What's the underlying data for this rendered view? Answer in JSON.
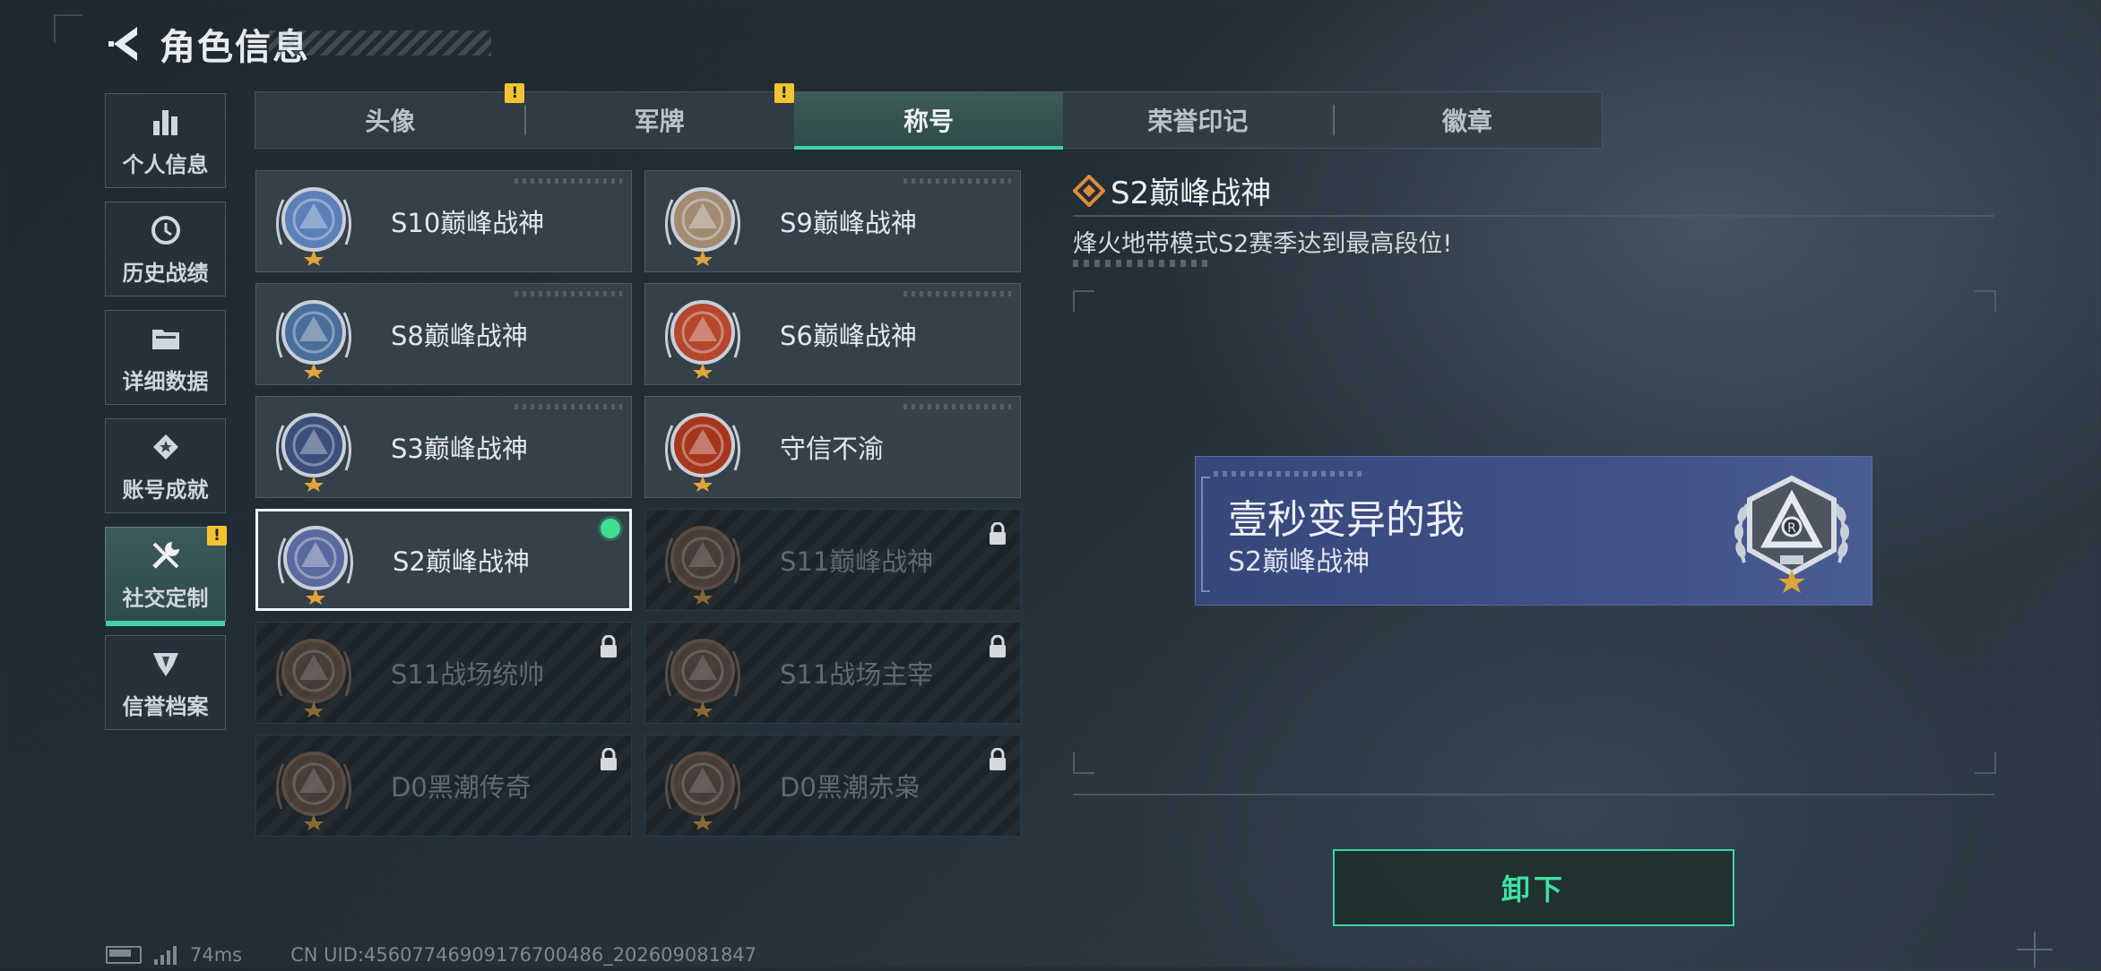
{
  "header": {
    "title": "角色信息",
    "back_icon": "back-arrow-icon"
  },
  "sidenav": [
    {
      "label": "个人信息",
      "icon": "bar-chart-icon",
      "badge": ""
    },
    {
      "label": "历史战绩",
      "icon": "clock-history-icon",
      "badge": ""
    },
    {
      "label": "详细数据",
      "icon": "folder-icon",
      "badge": ""
    },
    {
      "label": "账号成就",
      "icon": "medal-icon",
      "badge": ""
    },
    {
      "label": "社交定制",
      "icon": "tools-icon",
      "badge": "!",
      "active": true
    },
    {
      "label": "信誉档案",
      "icon": "shield-emblem-icon",
      "badge": ""
    }
  ],
  "tabs": [
    {
      "label": "头像",
      "badge": "!"
    },
    {
      "label": "军牌",
      "badge": "!"
    },
    {
      "label": "称号",
      "badge": "",
      "active": true
    },
    {
      "label": "荣誉印记",
      "badge": ""
    },
    {
      "label": "徽章",
      "badge": ""
    }
  ],
  "titles": [
    {
      "label": "S10巅峰战神",
      "state": "unlocked",
      "emblem": "s10-emblem",
      "color": "#5b7fb8"
    },
    {
      "label": "S9巅峰战神",
      "state": "unlocked",
      "emblem": "s9-emblem",
      "color": "#a08a72"
    },
    {
      "label": "S8巅峰战神",
      "state": "unlocked",
      "emblem": "s8-emblem",
      "color": "#4a6e9a"
    },
    {
      "label": "S6巅峰战神",
      "state": "unlocked",
      "emblem": "s6-emblem",
      "color": "#b5472e"
    },
    {
      "label": "S3巅峰战神",
      "state": "unlocked",
      "emblem": "s3-emblem",
      "color": "#3a4f7a"
    },
    {
      "label": "守信不渝",
      "state": "unlocked",
      "emblem": "scales-emblem",
      "color": "#a8361f"
    },
    {
      "label": "S2巅峰战神",
      "state": "equipped",
      "emblem": "s2-emblem",
      "color": "#5a6aa0"
    },
    {
      "label": "S11巅峰战神",
      "state": "locked",
      "emblem": "s11-emblem",
      "color": "#6a5040"
    },
    {
      "label": "S11战场统帅",
      "state": "locked",
      "emblem": "tank-emblem",
      "color": "#6a5040"
    },
    {
      "label": "S11战场主宰",
      "state": "locked",
      "emblem": "arch-emblem",
      "color": "#6a5040"
    },
    {
      "label": "D0黑潮传奇",
      "state": "locked",
      "emblem": "hooded-emblem",
      "color": "#6a5040"
    },
    {
      "label": "D0黑潮赤枭",
      "state": "locked",
      "emblem": "skull-emblem",
      "color": "#6a5040"
    }
  ],
  "detail": {
    "title": "S2巅峰战神",
    "description": "烽火地带模式S2赛季达到最高段位!",
    "preview_name": "壹秒变异的我",
    "preview_title": "S2巅峰战神"
  },
  "actions": {
    "unequip_label": "卸下"
  },
  "status": {
    "latency": "74ms",
    "uid": "CN UID:45607746909176700486_202609081847"
  },
  "colors": {
    "accent": "#3fd4a8",
    "badge": "#f2c431",
    "equipped": "#3ee08f"
  }
}
